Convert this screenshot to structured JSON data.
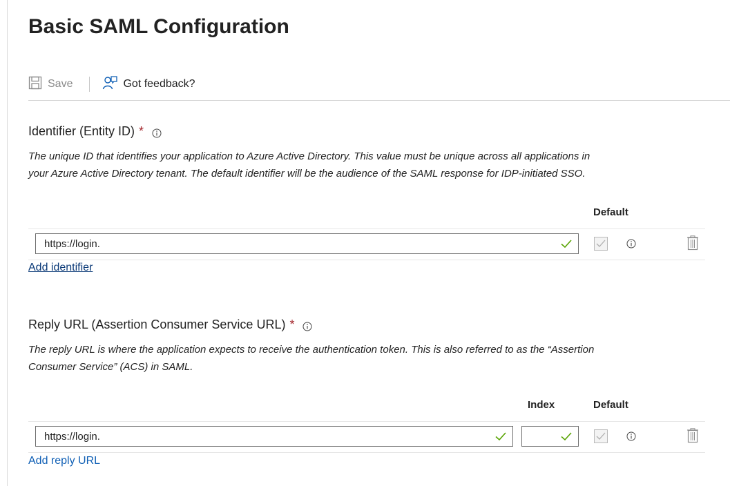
{
  "page": {
    "title": "Basic SAML Configuration"
  },
  "toolbar": {
    "save_label": "Save",
    "feedback_label": "Got feedback?"
  },
  "identifier": {
    "title": "Identifier (Entity ID)",
    "required_mark": "*",
    "description_line1": "The unique ID that identifies your application to Azure Active Directory. This value must be unique across all applications in",
    "description_line2": "your Azure Active Directory tenant. The default identifier will be the audience of the SAML response for IDP-initiated SSO.",
    "col_default": "Default",
    "value": "https://login.",
    "add_link": "Add identifier"
  },
  "reply": {
    "title": "Reply URL (Assertion Consumer Service URL)",
    "required_mark": "*",
    "description_line1": "The reply URL is where the application expects to receive the authentication token. This is also referred to as the “Assertion",
    "description_line2": "Consumer Service” (ACS) in SAML.",
    "col_index": "Index",
    "col_default": "Default",
    "value": "https://login.",
    "index_value": "",
    "add_link": "Add reply URL"
  },
  "colors": {
    "accent": "#0f5fb5",
    "required": "#a4262c",
    "valid": "#57a300"
  },
  "icons": [
    "save-icon",
    "feedback-icon",
    "info-icon",
    "checkmark-icon",
    "trash-icon"
  ]
}
